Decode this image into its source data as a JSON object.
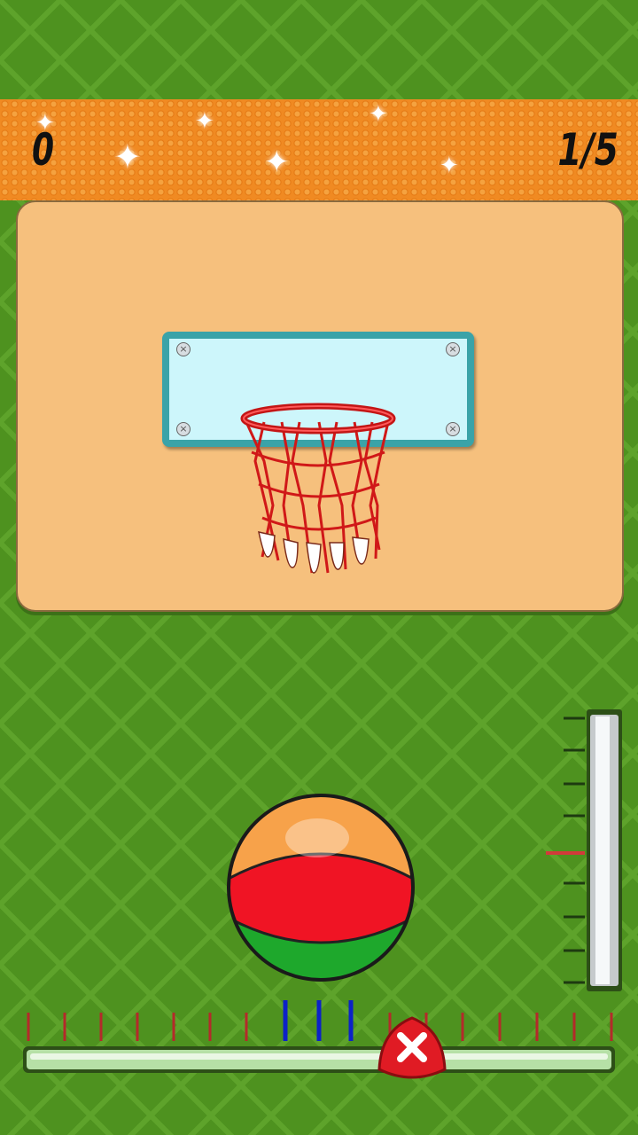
{
  "hud": {
    "score": "0",
    "shots": "1/5"
  },
  "icons": {
    "cancel": "close-icon",
    "sparkle": "sparkle-icon",
    "bolt": "screw-icon"
  },
  "colors": {
    "rim": "#e02020",
    "ball_top": "#f7a24a",
    "ball_mid": "#f01424",
    "ball_bottom": "#1ea82c",
    "meter_marker": "#d23a3a",
    "aim_marker": "#0c22c8"
  },
  "power_meter": {
    "level_fraction": 0.55
  },
  "aim_bar": {
    "position_fraction": 0.66
  }
}
